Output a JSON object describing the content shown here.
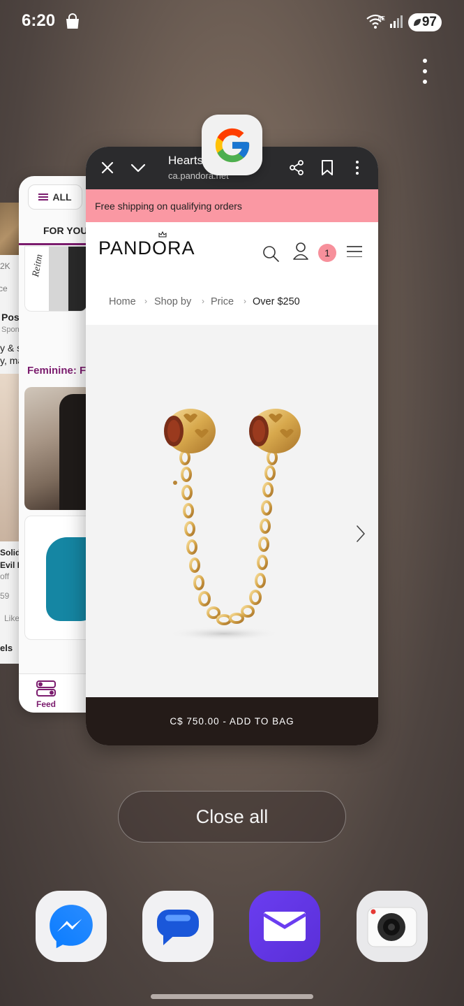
{
  "status_bar": {
    "time": "6:20",
    "wifi_badge": "6E",
    "battery": "97"
  },
  "recents": {
    "front_app": {
      "browser_icon": "google-icon",
      "tab_title": "Hearts",
      "tab_url": "ca.pandora.net",
      "promo_text": "Free shipping on qualifying orders",
      "logo": "PANDORA",
      "cart_count": "1",
      "breadcrumbs": [
        "Home",
        "Shop by",
        "Price",
        "Over $250"
      ],
      "add_to_bag": "C$ 750.00 - ADD TO BAG"
    },
    "middle_app": {
      "filter_label": "ALL",
      "tab_label": "FOR YOU",
      "brand_text": "Reitm",
      "section_title": "Feminine: F",
      "nav_feed": "Feed",
      "accent_color": "#7b1c6e"
    },
    "far_app": {
      "count": "2K",
      "text_ce": "ce",
      "text_pos": "Pos",
      "text_spon": "Spon",
      "text_ys": "y & s",
      "text_yma": "y, ma",
      "text_solid": "Solid",
      "text_evil": "Evil E",
      "text_off": "off",
      "text_59": "59",
      "text_like": "Like",
      "text_els": "els"
    },
    "close_all_label": "Close all"
  },
  "dock": [
    {
      "name": "messenger-icon"
    },
    {
      "name": "messages-icon"
    },
    {
      "name": "email-icon"
    },
    {
      "name": "camera-icon"
    }
  ],
  "colors": {
    "promo_bg": "#fa98a3",
    "add_to_bag_bg": "#241b18",
    "chrome_bar_bg": "#2b2b2d"
  }
}
